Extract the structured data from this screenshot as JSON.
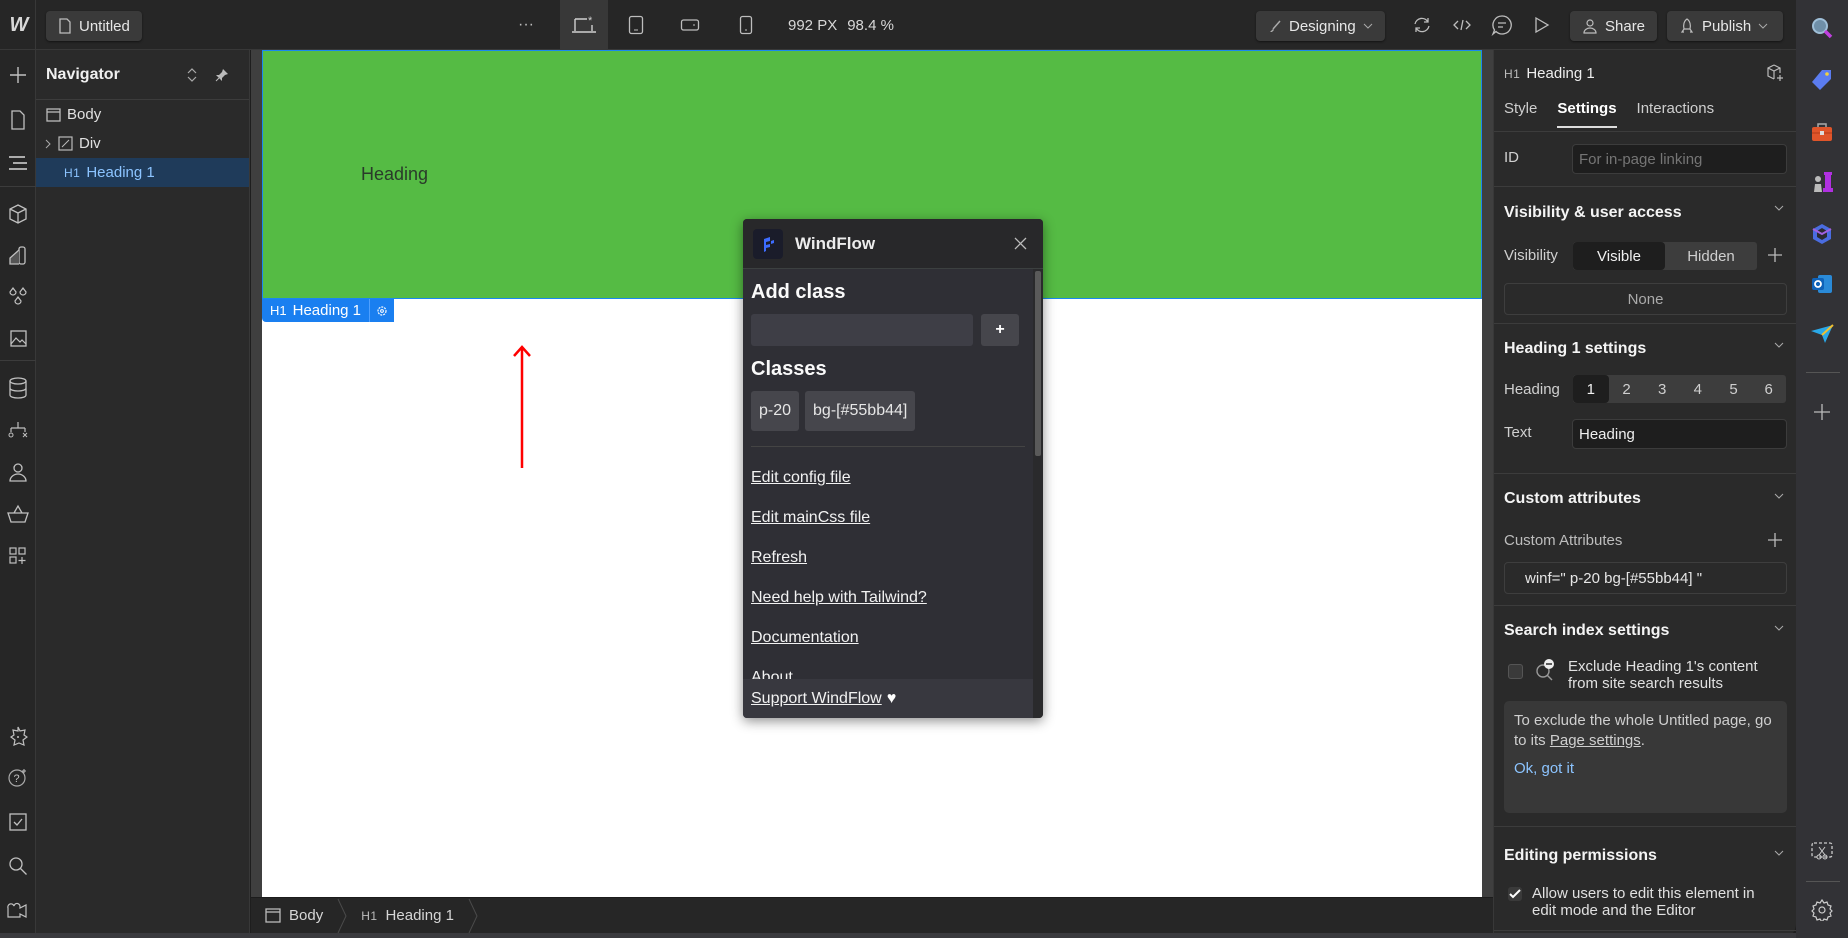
{
  "topbar": {
    "page_name": "Untitled",
    "more_label": "···",
    "breakpoints": [
      "desktop-base",
      "tablet",
      "mobile-landscape",
      "mobile-portrait"
    ],
    "width_readout": "992 PX",
    "zoom_readout": "98.4 %",
    "mode_label": "Designing",
    "share_label": "Share",
    "publish_label": "Publish"
  },
  "navigator": {
    "title": "Navigator",
    "items": [
      {
        "tag": "",
        "label": "Body",
        "icon": "body-icon"
      },
      {
        "tag": "",
        "label": "Div",
        "icon": "div-icon"
      },
      {
        "tag": "H1",
        "label": "Heading 1",
        "icon": "",
        "selected": true
      }
    ]
  },
  "canvas": {
    "heading_text": "Heading",
    "heading_bg": "#55bb44",
    "selection_tag": "H1",
    "selection_label": "Heading 1"
  },
  "breadcrumb": [
    {
      "tag": "",
      "label": "Body"
    },
    {
      "tag": "H1",
      "label": "Heading 1"
    }
  ],
  "windflow": {
    "title": "WindFlow",
    "add_class_heading": "Add class",
    "add_class_placeholder": "",
    "add_button": "+",
    "classes_heading": "Classes",
    "classes": [
      "p-20",
      "bg-[#55bb44]"
    ],
    "links": [
      "Edit config file",
      "Edit mainCss file",
      "Refresh",
      "Need help with Tailwind?",
      "Documentation",
      "About"
    ],
    "support_link": "Support WindFlow",
    "support_icon": "♥"
  },
  "right_panel": {
    "element_tag": "H1",
    "element_name": "Heading 1",
    "tabs": [
      {
        "label": "Style",
        "active": false
      },
      {
        "label": "Settings",
        "active": true
      },
      {
        "label": "Interactions",
        "active": false
      }
    ],
    "id_label": "ID",
    "id_placeholder": "For in-page linking",
    "visibility": {
      "title": "Visibility & user access",
      "label": "Visibility",
      "options": [
        "Visible",
        "Hidden"
      ],
      "selected": "Visible",
      "access_value": "None"
    },
    "heading_settings": {
      "title": "Heading 1 settings",
      "heading_label": "Heading",
      "levels": [
        "1",
        "2",
        "3",
        "4",
        "5",
        "6"
      ],
      "selected_level": "1",
      "text_label": "Text",
      "text_value": "Heading"
    },
    "custom_attributes": {
      "title": "Custom attributes",
      "label": "Custom Attributes",
      "value": "winf=\" p-20 bg-[#55bb44] \""
    },
    "search_index": {
      "title": "Search index settings",
      "checkbox_label": "Exclude Heading 1's content from site search results",
      "checked": false,
      "note_text": "To exclude the whole Untitled page, go to its",
      "note_link": "Page settings",
      "note_end": ".",
      "dismiss": "Ok, got it"
    },
    "editing_permissions": {
      "title": "Editing permissions",
      "checkbox_label": "Allow users to edit this element in edit mode and the Editor",
      "checked": true
    }
  },
  "colors": {
    "accent": "#1a7ff0",
    "selected_nav_bg": "#1f3b5a",
    "annotation_arrow": "#ff0000"
  }
}
